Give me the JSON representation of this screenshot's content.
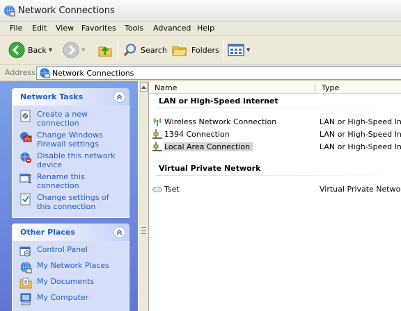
{
  "window": {
    "title": "Network Connections"
  },
  "menu": [
    "File",
    "Edit",
    "View",
    "Favorites",
    "Tools",
    "Advanced",
    "Help"
  ],
  "toolbar": {
    "back_label": "Back",
    "search_label": "Search",
    "folders_label": "Folders"
  },
  "address": {
    "label": "Address",
    "value": "Network Connections"
  },
  "network_tasks": {
    "title": "Network Tasks",
    "items": [
      {
        "label": "Create a new connection",
        "icon": "new-connection-icon"
      },
      {
        "label": "Change Windows Firewall settings",
        "icon": "firewall-icon"
      },
      {
        "label": "Disable this network device",
        "icon": "disable-network-icon"
      },
      {
        "label": "Rename this connection",
        "icon": "rename-icon"
      },
      {
        "label": "Change settings of this connection",
        "icon": "settings-icon"
      }
    ]
  },
  "other_places": {
    "title": "Other Places",
    "items": [
      {
        "label": "Control Panel",
        "icon": "control-panel-icon"
      },
      {
        "label": "My Network Places",
        "icon": "network-places-icon"
      },
      {
        "label": "My Documents",
        "icon": "my-documents-icon"
      },
      {
        "label": "My Computer",
        "icon": "my-computer-icon"
      }
    ]
  },
  "columns": {
    "name": "Name",
    "type": "Type"
  },
  "groups": [
    {
      "title": "LAN or High-Speed Internet",
      "rows": [
        {
          "name": "Wireless Network Connection",
          "type": "LAN or High-Speed Internet",
          "icon": "wireless-connection-icon",
          "selected": false
        },
        {
          "name": "1394 Connection",
          "type": "LAN or High-Speed Internet",
          "icon": "lan-connection-icon",
          "selected": false
        },
        {
          "name": "Local Area Connection",
          "type": "LAN or High-Speed Internet",
          "icon": "lan-connection-icon",
          "selected": true
        }
      ]
    },
    {
      "title": "Virtual Private Network",
      "rows": [
        {
          "name": "Tset",
          "type": "Virtual Private Network",
          "icon": "vpn-connection-icon",
          "selected": false
        }
      ]
    }
  ],
  "colors": {
    "pane_gradient_top": "#7ba2e7",
    "pane_gradient_bottom": "#6375d6",
    "link_blue": "#215dc6",
    "panel_body": "#d6dff7",
    "selection": "#d5d5d5"
  }
}
